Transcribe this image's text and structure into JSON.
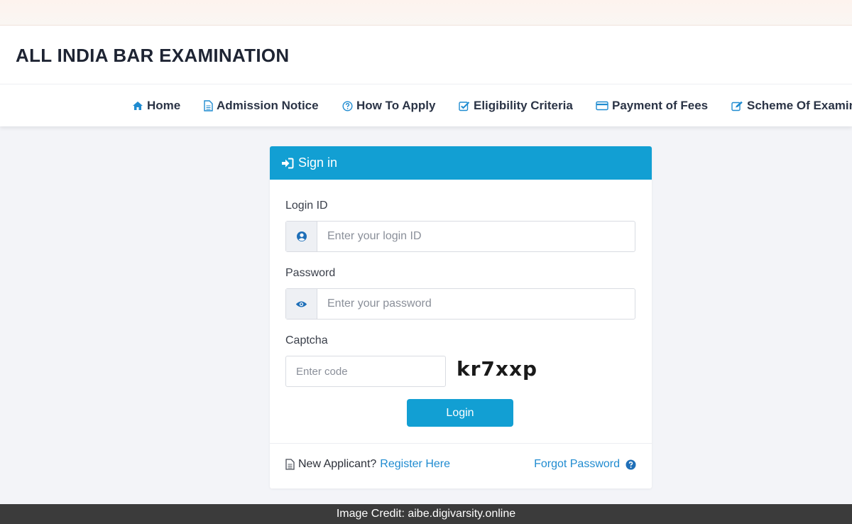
{
  "site": {
    "title": "ALL INDIA BAR EXAMINATION"
  },
  "nav": {
    "items": [
      {
        "label": "Home",
        "icon": "home-icon"
      },
      {
        "label": "Admission Notice",
        "icon": "document-icon"
      },
      {
        "label": "How To Apply",
        "icon": "question-circle-icon"
      },
      {
        "label": "Eligibility Criteria",
        "icon": "check-square-icon"
      },
      {
        "label": "Payment of Fees",
        "icon": "credit-card-icon"
      },
      {
        "label": "Scheme Of Examin",
        "icon": "edit-icon"
      }
    ]
  },
  "signin": {
    "title": "Sign in",
    "login_label": "Login ID",
    "login_placeholder": "Enter your login ID",
    "password_label": "Password",
    "password_placeholder": "Enter your password",
    "captcha_label": "Captcha",
    "captcha_placeholder": "Enter code",
    "captcha_code": "kr7xxp",
    "login_button": "Login",
    "new_applicant": "New Applicant?",
    "register_link": "Register Here",
    "forgot_link": "Forgot Password"
  },
  "credit": {
    "text": "Image Credit: aibe.digivarsity.online"
  },
  "colors": {
    "accent": "#129fd3",
    "link": "#1f8bd0",
    "title": "#1e2433",
    "nav_icon": "#1f8bd0"
  }
}
